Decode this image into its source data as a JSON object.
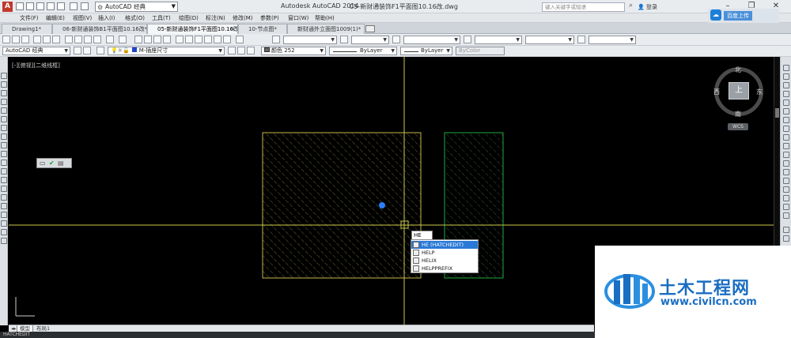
{
  "window": {
    "app_title": "Autodesk AutoCAD 2014",
    "file_title": "05-新财通装饰F1平面图10.16改.dwg",
    "workspace": "AutoCAD 经典",
    "search_placeholder": "键入关键字或短语",
    "login_label": "登录"
  },
  "menu": [
    "文件(F)",
    "编辑(E)",
    "视图(V)",
    "插入(I)",
    "格式(O)",
    "工具(T)",
    "绘图(D)",
    "标注(N)",
    "修改(M)",
    "参数(P)",
    "窗口(W)",
    "帮助(H)"
  ],
  "cloud_upload": {
    "label": "百度上传"
  },
  "tabs": [
    {
      "label": "Drawing1*",
      "active": false
    },
    {
      "label": "06-新财通装饰B1平面图10.16改*",
      "active": false
    },
    {
      "label": "05-新财通装饰F1平面图10.16改*",
      "active": true
    },
    {
      "label": "10-节点图*",
      "active": false
    },
    {
      "label": "新财通外立面图1009(1)*",
      "active": false
    }
  ],
  "properties": {
    "workspace2": "AutoCAD 经典",
    "layer": "M-插座尺寸",
    "color": "颜色 252",
    "linetype": "ByLayer",
    "lineweight": "ByLayer",
    "plotstyle": "ByColor"
  },
  "canvas": {
    "view_label": "[-][俯视][二维线框]",
    "viewcube": {
      "north": "北",
      "south": "南",
      "east": "东",
      "west": "西",
      "face": "上",
      "wcs": "WCS"
    }
  },
  "autocomplete": {
    "input_text": "HE",
    "items": [
      {
        "label": "HE (HATCHEDIT)",
        "selected": true
      },
      {
        "label": "HELP",
        "selected": false
      },
      {
        "label": "HELIX",
        "selected": false
      },
      {
        "label": "HELPPREFIX",
        "selected": false
      }
    ]
  },
  "layout_tabs": [
    {
      "label": "模型",
      "active": true
    },
    {
      "label": "布局1",
      "active": false
    }
  ],
  "command_line": "HATCHEDIT",
  "watermark": {
    "site_name": "土木工程网",
    "url": "www.civilcn.com"
  },
  "colors": {
    "canvas_bg": "#000000",
    "crosshair": "#c8c84a",
    "hatch_yellow": "#c8b94a",
    "hatch_green": "#1faa3c",
    "grip_blue": "#2a7fff",
    "accent_blue": "#2a79d6"
  }
}
